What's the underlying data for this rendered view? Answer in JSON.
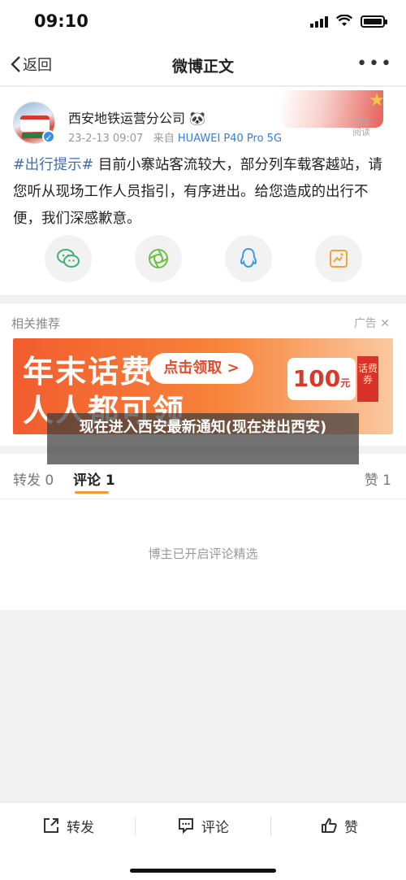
{
  "status_bar": {
    "time": "09:10"
  },
  "nav": {
    "back_label": "返回",
    "title": "微博正文",
    "more": "•••"
  },
  "post": {
    "author": "西安地铁运营分公司",
    "author_emoji": "🐼",
    "date": "23-2-13 09:07",
    "from_prefix": "来自",
    "device": "HUAWEI P40 Pro 5G",
    "reads_count": "258",
    "reads_label": "阅读",
    "hashtag": "#出行提示#",
    "text": " 目前小寨站客流较大，部分列车载客越站，请您听从现场工作人员指引，有序进出。给您造成的出行不便，我们深感歉意。",
    "share_icons": [
      "wechat-icon",
      "moments-icon",
      "qq-icon",
      "qzone-icon"
    ]
  },
  "recommend": {
    "title": "相关推荐",
    "ad_label": "广告",
    "ad_line1": "年末话费",
    "ad_line2": "人人都可领",
    "ad_cta": "点击领取 >",
    "ad_coupon_value": "100",
    "ad_coupon_unit": "元",
    "ad_tag": "话费券"
  },
  "overlay": {
    "text": "现在进入西安最新通知(现在进出西安)"
  },
  "tabs": {
    "repost": "转发 0",
    "comment": "评论 1",
    "like": "赞 1"
  },
  "comments": {
    "empty_text": "博主已开启评论精选"
  },
  "bottom_bar": {
    "repost": "转发",
    "comment": "评论",
    "like": "赞"
  },
  "colors": {
    "accent": "#f39a2e",
    "link": "#3a6db5",
    "ad": "#f25c2e"
  }
}
